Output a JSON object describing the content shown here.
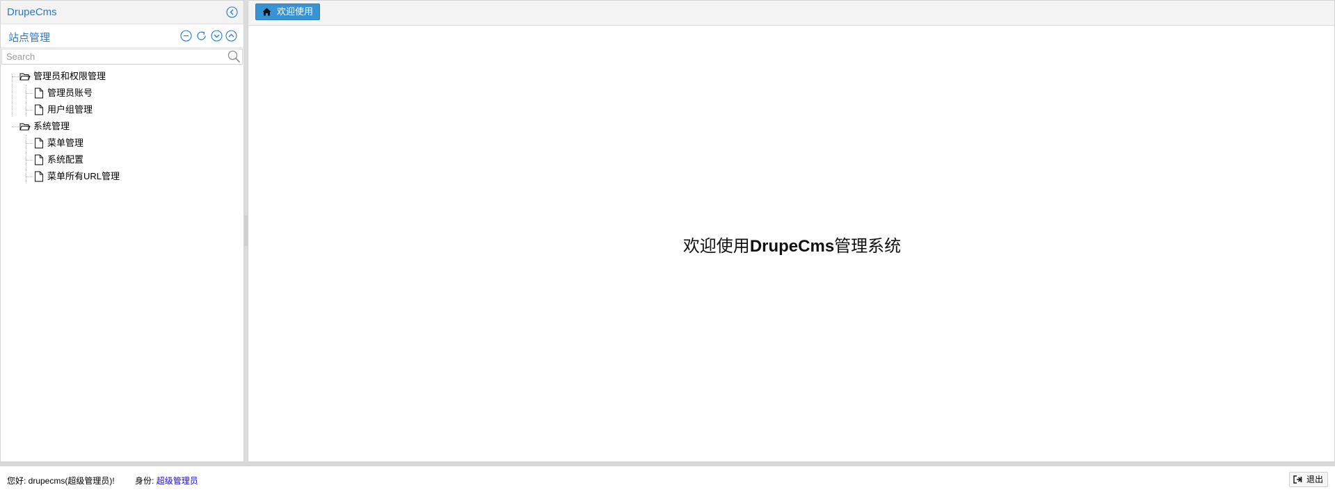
{
  "app": {
    "title": "DrupeCms"
  },
  "sidebar": {
    "section_title": "站点管理",
    "search_placeholder": "Search",
    "tree": [
      {
        "label": "管理员和权限管理",
        "type": "folder",
        "children": [
          {
            "label": "管理员账号"
          },
          {
            "label": "用户组管理"
          }
        ]
      },
      {
        "label": "系统管理",
        "type": "folder",
        "children": [
          {
            "label": "菜单管理"
          },
          {
            "label": "系统配置"
          },
          {
            "label": "菜单所有URL管理"
          }
        ]
      }
    ],
    "toolbar_icons": [
      "minus-circle-icon",
      "refresh-icon",
      "expand-down-icon",
      "collapse-up-icon"
    ]
  },
  "tabs": [
    {
      "label": "欢迎使用",
      "icon": "home-icon",
      "active": true
    }
  ],
  "main": {
    "welcome_prefix": "欢迎使用",
    "welcome_brand": "DrupeCms",
    "welcome_suffix": "管理系统"
  },
  "footer": {
    "greeting": "您好: drupecms(超级管理员)!",
    "identity_label": "身份:",
    "identity_value": "超级管理员",
    "logout_label": "退出"
  },
  "colors": {
    "accent": "#2b78c5",
    "tab_active": "#3793d3",
    "link": "#1a0dcc"
  }
}
